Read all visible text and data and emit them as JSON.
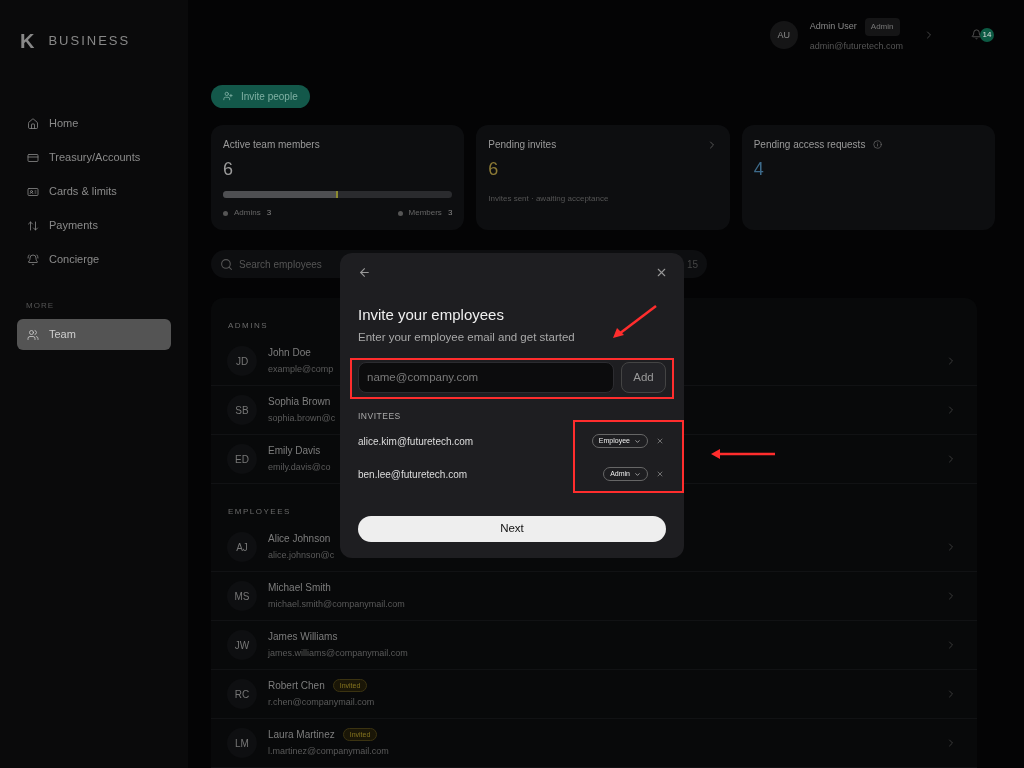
{
  "brand": {
    "logo": "K",
    "name": "BUSINESS"
  },
  "sidebar": {
    "items": [
      {
        "label": "Home",
        "selected": false
      },
      {
        "label": "Treasury/Accounts",
        "selected": false
      },
      {
        "label": "Cards & limits",
        "selected": false
      },
      {
        "label": "Payments",
        "selected": false
      },
      {
        "label": "Concierge",
        "selected": false
      }
    ],
    "section": "MORE",
    "more_items": [
      {
        "label": "Team",
        "selected": true
      }
    ]
  },
  "header": {
    "avatar": "AU",
    "name": "Admin User",
    "role": "Admin",
    "email": "admin@futuretech.com",
    "notifications": "14"
  },
  "invite_button": "Invite people",
  "stats": [
    {
      "kind": "members",
      "title": "Active team members",
      "value": "6",
      "level": 0.5,
      "legend": [
        {
          "label": "Admins",
          "count": "3"
        },
        {
          "label": "Members",
          "count": "3"
        }
      ]
    },
    {
      "kind": "invites",
      "title": "Pending invites",
      "value": "6",
      "note": "Invites sent · awaiting acceptance"
    },
    {
      "kind": "requests",
      "title": "Pending access requests",
      "value": "4"
    }
  ],
  "search": {
    "placeholder": "Search employees",
    "count": "15"
  },
  "groups": [
    {
      "title": "ADMINS",
      "rows": [
        {
          "initials": "JD",
          "name": "John Doe",
          "email": "example@comp"
        },
        {
          "initials": "SB",
          "name": "Sophia Brown",
          "email": "sophia.brown@c"
        },
        {
          "initials": "ED",
          "name": "Emily Davis",
          "email": "emily.davis@co"
        }
      ]
    },
    {
      "title": "EMPLOYEES",
      "rows": [
        {
          "initials": "AJ",
          "name": "Alice Johnson",
          "email": "alice.johnson@c"
        },
        {
          "initials": "MS",
          "name": "Michael Smith",
          "email": "michael.smith@companymail.com"
        },
        {
          "initials": "JW",
          "name": "James Williams",
          "email": "james.williams@companymail.com"
        },
        {
          "initials": "RC",
          "name": "Robert Chen",
          "email": "r.chen@companymail.com",
          "badge": "Invited"
        },
        {
          "initials": "LM",
          "name": "Laura Martinez",
          "email": "l.martinez@companymail.com",
          "badge": "Invited"
        }
      ]
    }
  ],
  "modal": {
    "title": "Invite your employees",
    "subtitle": "Enter your employee email and get started",
    "placeholder": "name@company.com",
    "add": "Add",
    "invitees_label": "INVITEES",
    "invitees": [
      {
        "email": "alice.kim@futuretech.com",
        "role": "Employee"
      },
      {
        "email": "ben.lee@futuretech.com",
        "role": "Admin"
      }
    ],
    "next": "Next"
  }
}
